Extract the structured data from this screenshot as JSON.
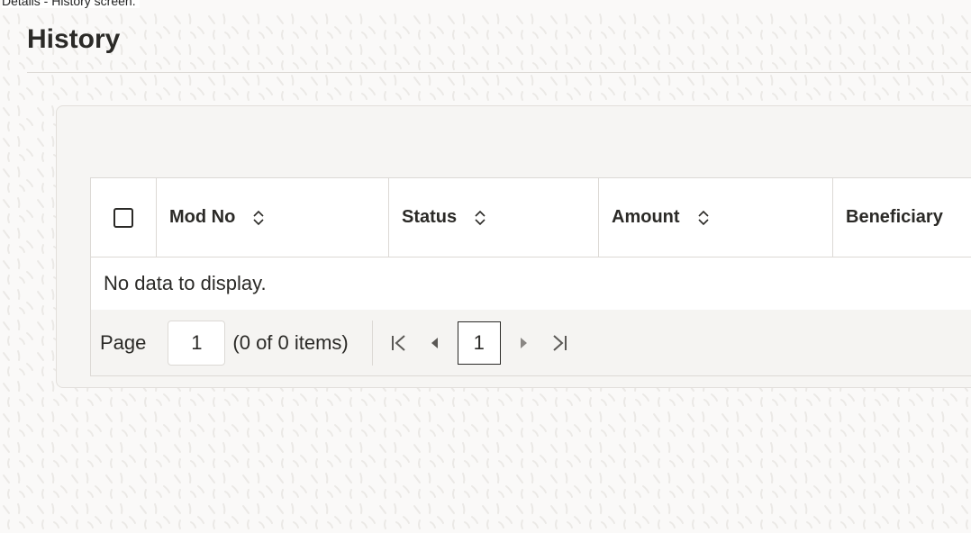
{
  "caption": "Details - History screen.",
  "page": {
    "title": "History"
  },
  "table": {
    "select_all_label": "",
    "columns": [
      {
        "label": "Mod No",
        "sortable": true
      },
      {
        "label": "Status",
        "sortable": true
      },
      {
        "label": "Amount",
        "sortable": true
      },
      {
        "label": "Beneficiary",
        "sortable": false
      }
    ],
    "empty_message": "No data to display."
  },
  "pager": {
    "page_label": "Page",
    "page_value": "1",
    "items_count": "(0 of 0 items)",
    "current_page": "1",
    "icons": {
      "first": "first-page-icon",
      "prev": "previous-page-icon",
      "next": "next-page-icon",
      "last": "last-page-icon"
    }
  },
  "colors": {
    "border": "#dcd9d5",
    "text": "#2b2a27",
    "card_bg": "#f6f5f3",
    "pager_bg": "#f5f4f2"
  }
}
